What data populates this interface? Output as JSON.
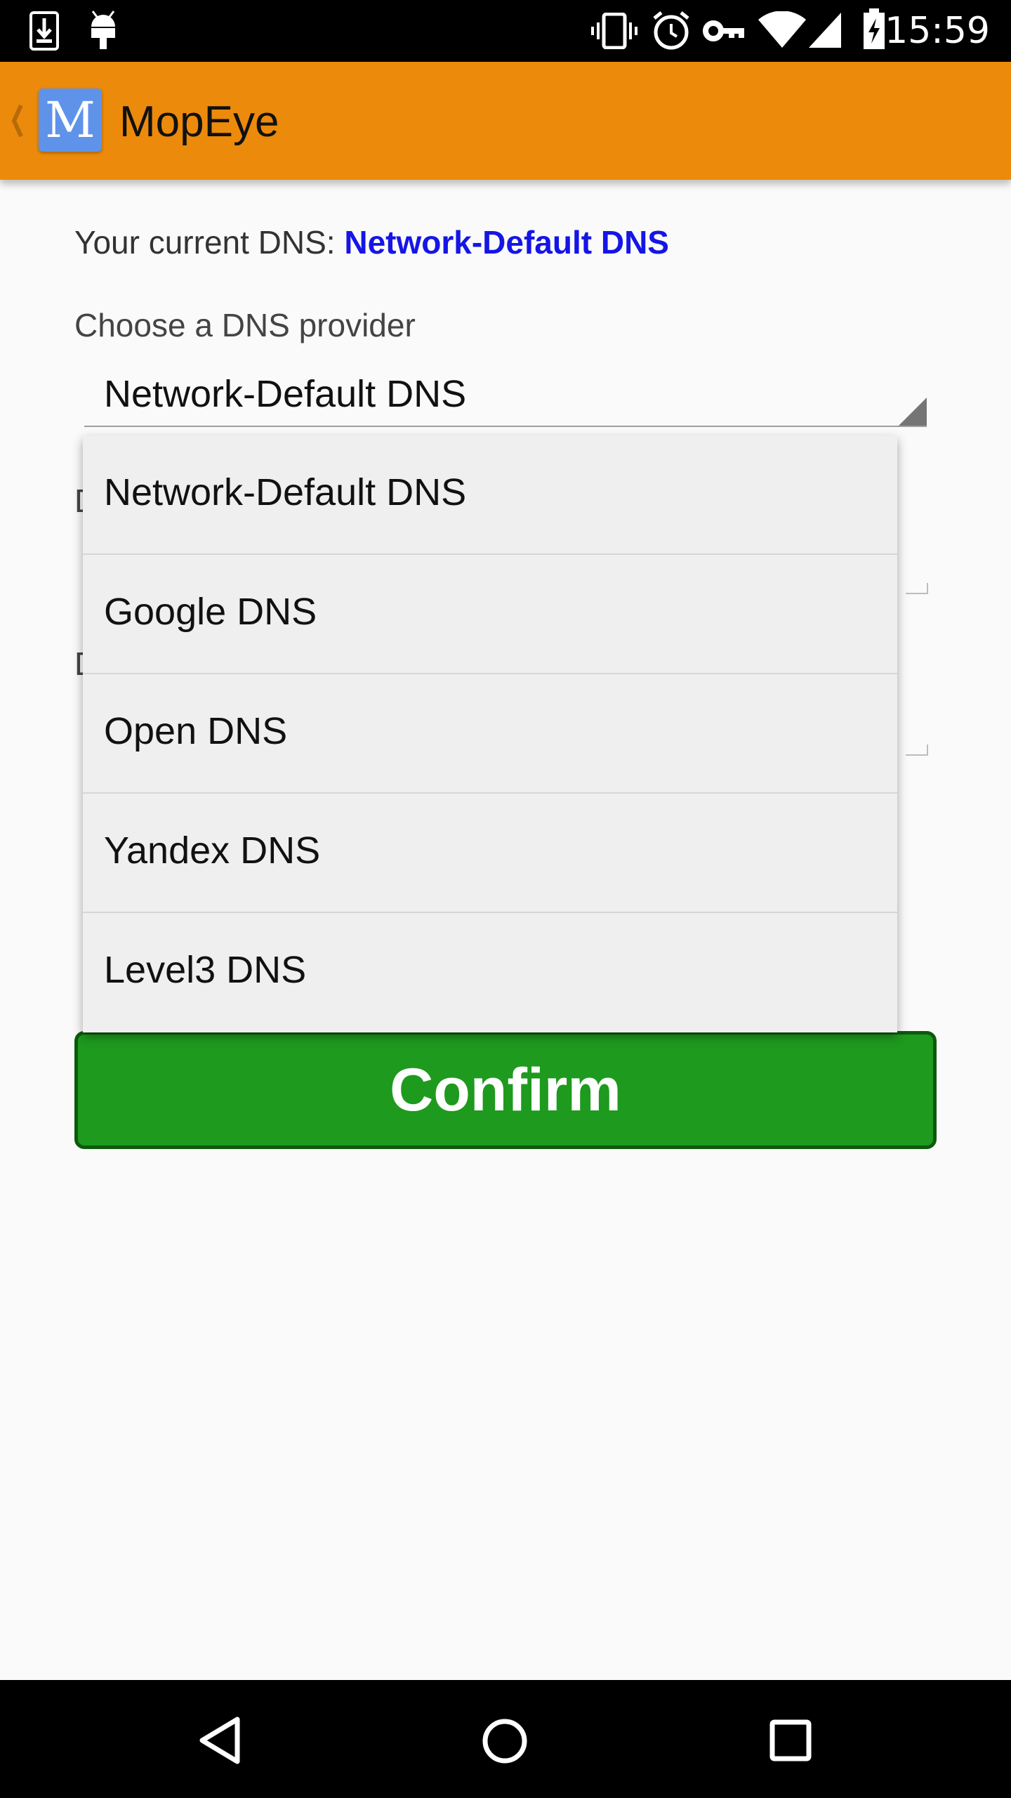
{
  "status_bar": {
    "time": "15:59",
    "icons": [
      "download-icon",
      "android-debug-icon",
      "vibrate-icon",
      "alarm-icon",
      "vpn-key-icon",
      "wifi-icon",
      "signal-icon",
      "battery-charging-icon"
    ]
  },
  "app_bar": {
    "title": "MopEye",
    "logo_letter": "M",
    "color": "#ec8a0c"
  },
  "content": {
    "current_dns_label": "Your current DNS: ",
    "current_dns_value": "Network-Default DNS",
    "choose_label": "Choose a DNS provider",
    "spinner_selected": "Network-Default DNS",
    "hidden_label_1": "D",
    "hidden_label_2": "D"
  },
  "dropdown": {
    "options": [
      {
        "label": "Network-Default DNS"
      },
      {
        "label": "Google DNS"
      },
      {
        "label": "Open DNS"
      },
      {
        "label": "Yandex DNS"
      },
      {
        "label": "Level3 DNS"
      }
    ]
  },
  "confirm": {
    "label": "Confirm",
    "color": "#1e9a1e"
  },
  "nav_bar": {
    "icons": [
      "back-icon",
      "home-icon",
      "recents-icon"
    ]
  }
}
